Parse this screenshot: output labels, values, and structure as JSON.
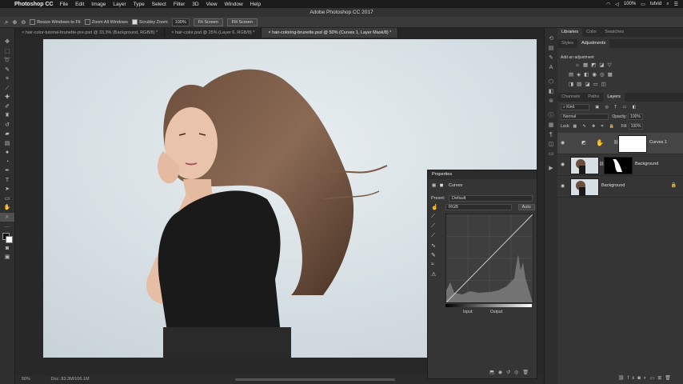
{
  "menubar": {
    "apple_glyph": "",
    "app_name": "Photoshop CC",
    "items": [
      "File",
      "Edit",
      "Image",
      "Layer",
      "Type",
      "Select",
      "Filter",
      "3D",
      "View",
      "Window",
      "Help"
    ],
    "battery": "100%",
    "user": "tutvid"
  },
  "window_title": "Adobe Photoshop CC 2017",
  "options": {
    "resize_windows": "Resize Windows to Fit",
    "zoom_all": "Zoom All Windows",
    "scrubby_zoom": "Scrubby Zoom",
    "zoom_value": "100%",
    "fit_screen": "Fit Screen",
    "fill_screen": "Fill Screen"
  },
  "tabs": [
    {
      "label": "hair-color-tutorial-brunette-pre.psd @ 33.3% (Background, RGB/8) *"
    },
    {
      "label": "hair-color.psd @ 25% (Layer 6, RGB/8) *"
    },
    {
      "label": "hair-coloring-brunette.psd @ 50% (Curves 1, Layer Mask/8) *"
    }
  ],
  "status": {
    "zoom": "50%",
    "doc": "Doc: 83.3M/106.1M"
  },
  "properties": {
    "title": "Properties",
    "type": "Curves",
    "preset_label": "Preset:",
    "preset_value": "Default",
    "channel": "RGB",
    "auto": "Auto",
    "input_label": "Input:",
    "output_label": "Output:"
  },
  "libraries": {
    "tabs": [
      "Libraries",
      "Color",
      "Swatches"
    ],
    "tabs2": [
      "Styles",
      "Adjustments"
    ],
    "add_adjustment": "Add an adjustment"
  },
  "layers_panel": {
    "tabs": [
      "Channels",
      "Paths",
      "Layers"
    ],
    "kind": "Kind",
    "blend": "Normal",
    "opacity_label": "Opacity:",
    "opacity": "100%",
    "lock_label": "Lock:",
    "fill_label": "Fill:",
    "fill": "100%",
    "layers": [
      {
        "name": "Curves 1"
      },
      {
        "name": "Background"
      },
      {
        "name": "Background"
      }
    ]
  },
  "colors": {
    "accent": "#2f6ccf",
    "bg": "#282828",
    "panel": "#353535"
  }
}
